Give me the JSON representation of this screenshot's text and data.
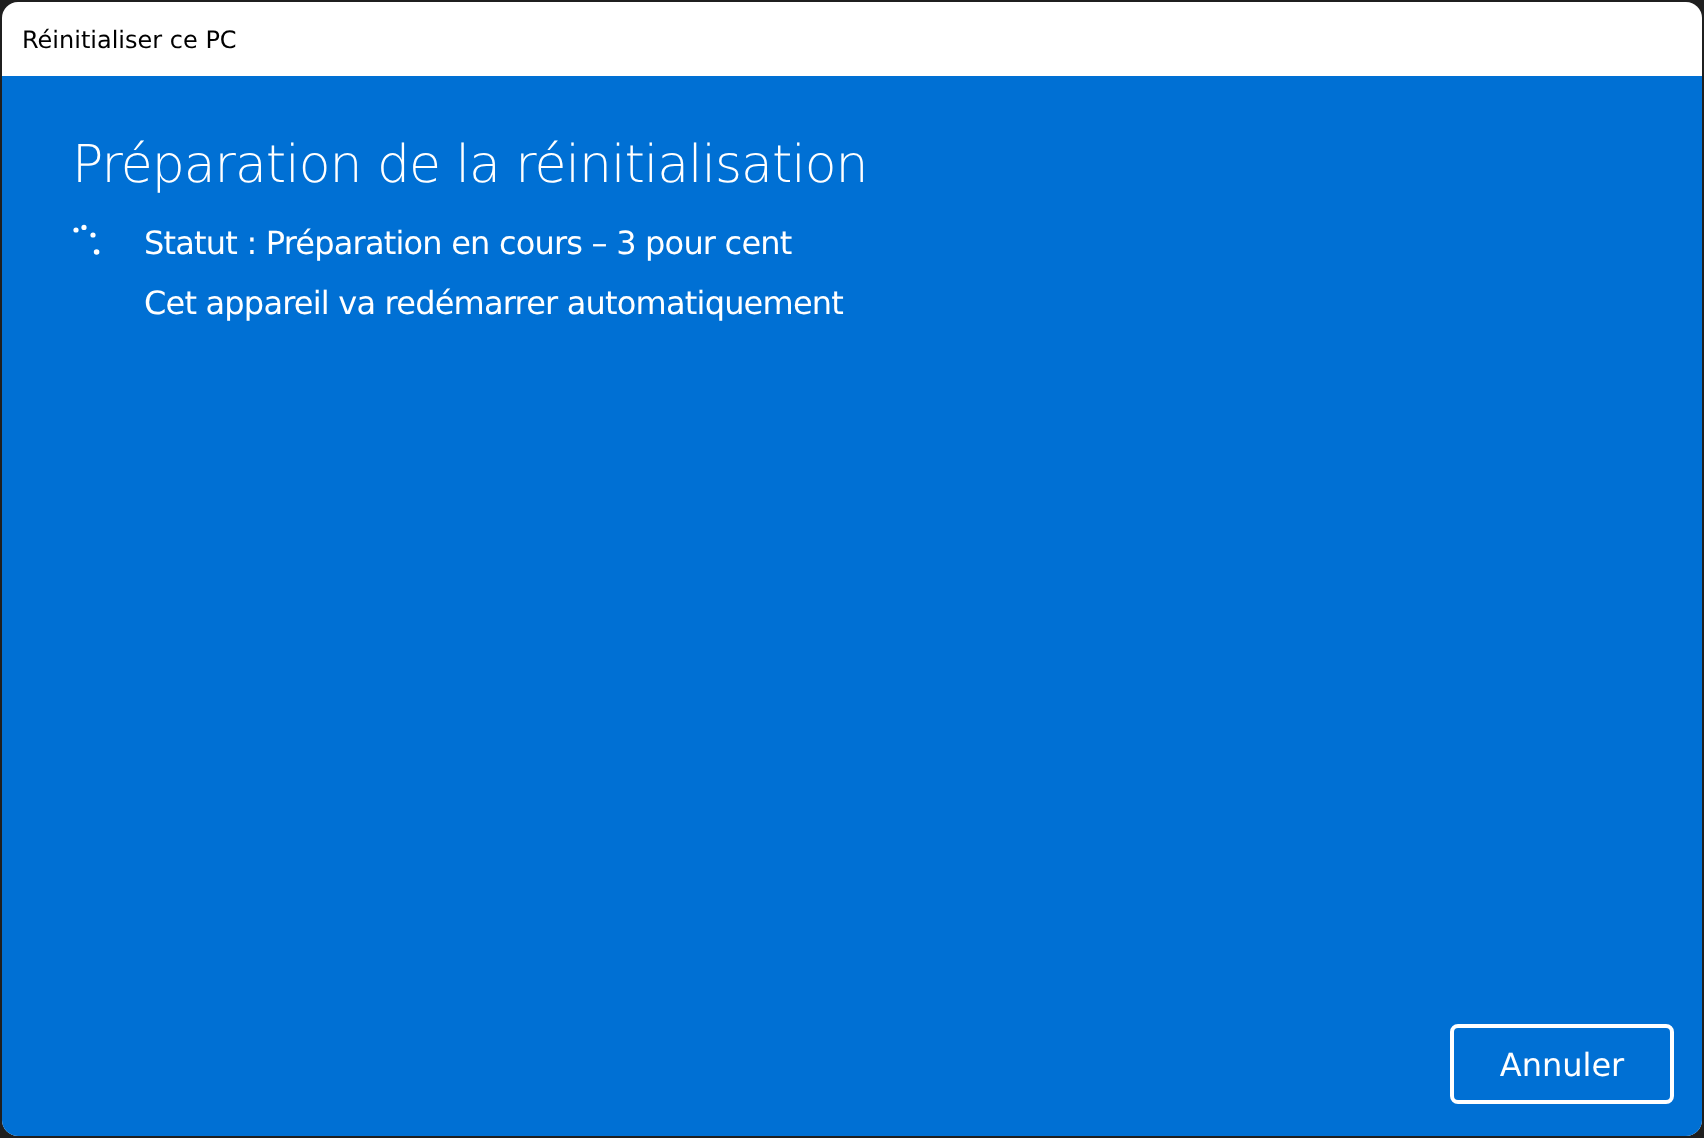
{
  "window": {
    "title": "Réinitialiser ce PC"
  },
  "heading": "Préparation de la réinitialisation",
  "status_lines": [
    "Statut : Préparation en cours – 3 pour cent",
    "Cet appareil va redémarrer automatiquement"
  ],
  "buttons": [
    {
      "label": "Annuler"
    }
  ]
}
